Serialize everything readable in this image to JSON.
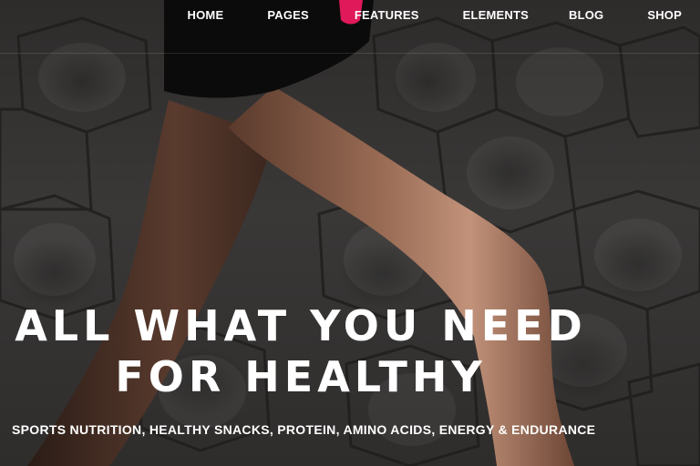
{
  "nav": {
    "items": [
      {
        "label": "HOME"
      },
      {
        "label": "PAGES"
      },
      {
        "label": "FEATURES"
      },
      {
        "label": "ELEMENTS"
      },
      {
        "label": "BLOG"
      },
      {
        "label": "SHOP"
      }
    ]
  },
  "hero": {
    "headline_line1": "ALL WHAT YOU NEED",
    "headline_line2": "FOR HEALTHY",
    "subheadline": "SPORTS NUTRITION, HEALTHY SNACKS, PROTEIN, AMINO ACIDS, ENERGY & ENDURANCE"
  },
  "colors": {
    "text": "#ffffff",
    "background": "#2e2c2b",
    "accent": "#e0195a"
  },
  "images": {
    "background": "photo-runner-legs-on-hexagonal-pavers"
  }
}
